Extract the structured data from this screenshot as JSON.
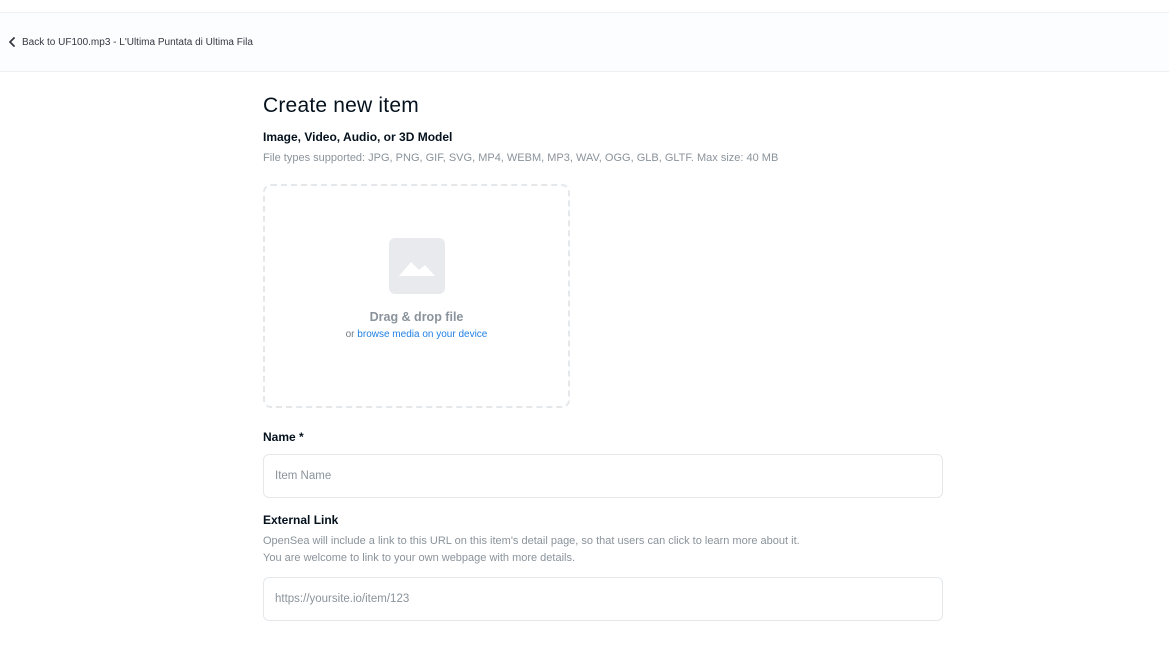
{
  "header": {
    "back_label": "Back to UF100.mp3 - L'Ultima Puntata di Ultima Fila"
  },
  "page": {
    "title": "Create new item"
  },
  "media": {
    "label": "Image, Video, Audio, or 3D Model",
    "help": "File types supported: JPG, PNG, GIF, SVG, MP4, WEBM, MP3, WAV, OGG, GLB, GLTF. Max size: 40 MB",
    "drag_label": "Drag & drop file",
    "browse_prefix": "or",
    "browse_link": "browse media on your device"
  },
  "name_field": {
    "label": "Name *",
    "placeholder": "Item Name"
  },
  "external_link": {
    "label": "External Link",
    "help_line1": "OpenSea will include a link to this URL on this item's detail page, so that users can click to learn more about it.",
    "help_line2": "You are welcome to link to your own webpage with more details.",
    "placeholder": "https://yoursite.io/item/123"
  },
  "colors": {
    "accent": "#2081e2",
    "muted_text": "#8a939b",
    "border": "#e5e8eb"
  },
  "icons": {
    "back": "chevron-left-icon",
    "media": "image-icon"
  }
}
